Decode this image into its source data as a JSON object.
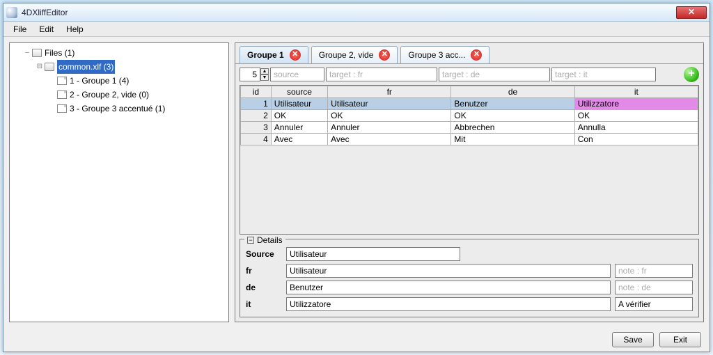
{
  "window": {
    "title": "4DXliffEditor"
  },
  "menu": {
    "file": "File",
    "edit": "Edit",
    "help": "Help"
  },
  "tree": {
    "root": "Files (1)",
    "file": "common.xlf (3)",
    "g1": "1 - Groupe 1 (4)",
    "g2": "2 - Groupe 2, vide (0)",
    "g3": "3 - Groupe 3 accentué (1)"
  },
  "tabs": [
    {
      "label": "Groupe 1"
    },
    {
      "label": "Groupe 2, vide"
    },
    {
      "label": "Groupe 3 acc..."
    }
  ],
  "filters": {
    "count": "5",
    "source_ph": "source",
    "fr_ph": "target : fr",
    "de_ph": "target : de",
    "it_ph": "target : it"
  },
  "columns": {
    "id": "id",
    "source": "source",
    "fr": "fr",
    "de": "de",
    "it": "it"
  },
  "rows": [
    {
      "id": "1",
      "source": "Utilisateur",
      "fr": "Utilisateur",
      "de": "Benutzer",
      "it": "Utilizzatore"
    },
    {
      "id": "2",
      "source": "OK",
      "fr": "OK",
      "de": "OK",
      "it": "OK"
    },
    {
      "id": "3",
      "source": "Annuler",
      "fr": "Annuler",
      "de": "Abbrechen",
      "it": "Annulla"
    },
    {
      "id": "4",
      "source": "Avec",
      "fr": "Avec",
      "de": "Mit",
      "it": "Con"
    }
  ],
  "details": {
    "legend": "Details",
    "labels": {
      "source": "Source",
      "fr": "fr",
      "de": "de",
      "it": "it"
    },
    "values": {
      "source": "Utilisateur",
      "fr": "Utilisateur",
      "de": "Benutzer",
      "it": "Utilizzatore"
    },
    "notes_ph": {
      "fr": "note : fr",
      "de": "note : de"
    },
    "notes_val": {
      "it": "A vérifier"
    }
  },
  "footer": {
    "save": "Save",
    "exit": "Exit"
  }
}
